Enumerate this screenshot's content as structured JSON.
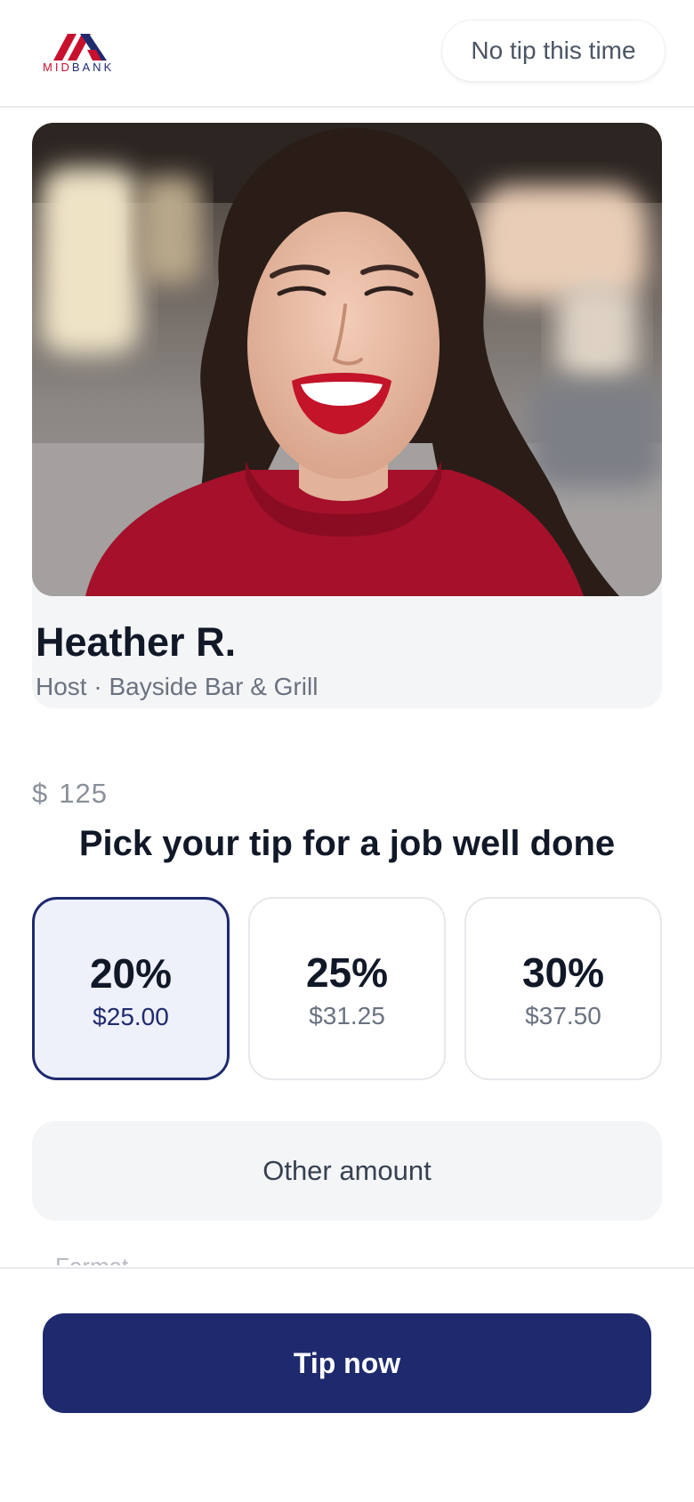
{
  "header": {
    "logo_text_mid": "MID",
    "logo_text_bank": "BANK",
    "skip_label": "No tip this time"
  },
  "employee": {
    "name": "Heather R.",
    "role": "Host · Bayside Bar & Grill"
  },
  "bill": {
    "currency": "$",
    "amount": "125"
  },
  "prompt": "Pick your tip for a job well done",
  "tips": [
    {
      "percent": "20%",
      "amount": "$25.00",
      "selected": true
    },
    {
      "percent": "25%",
      "amount": "$31.25",
      "selected": false
    },
    {
      "percent": "30%",
      "amount": "$37.50",
      "selected": false
    }
  ],
  "other_amount_label": "Other amount",
  "partially_hidden_label": "Format",
  "submit_label": "Tip now",
  "colors": {
    "brand_navy": "#1f2a6e",
    "brand_red": "#c8102e",
    "selected_bg": "#eef0fa"
  }
}
